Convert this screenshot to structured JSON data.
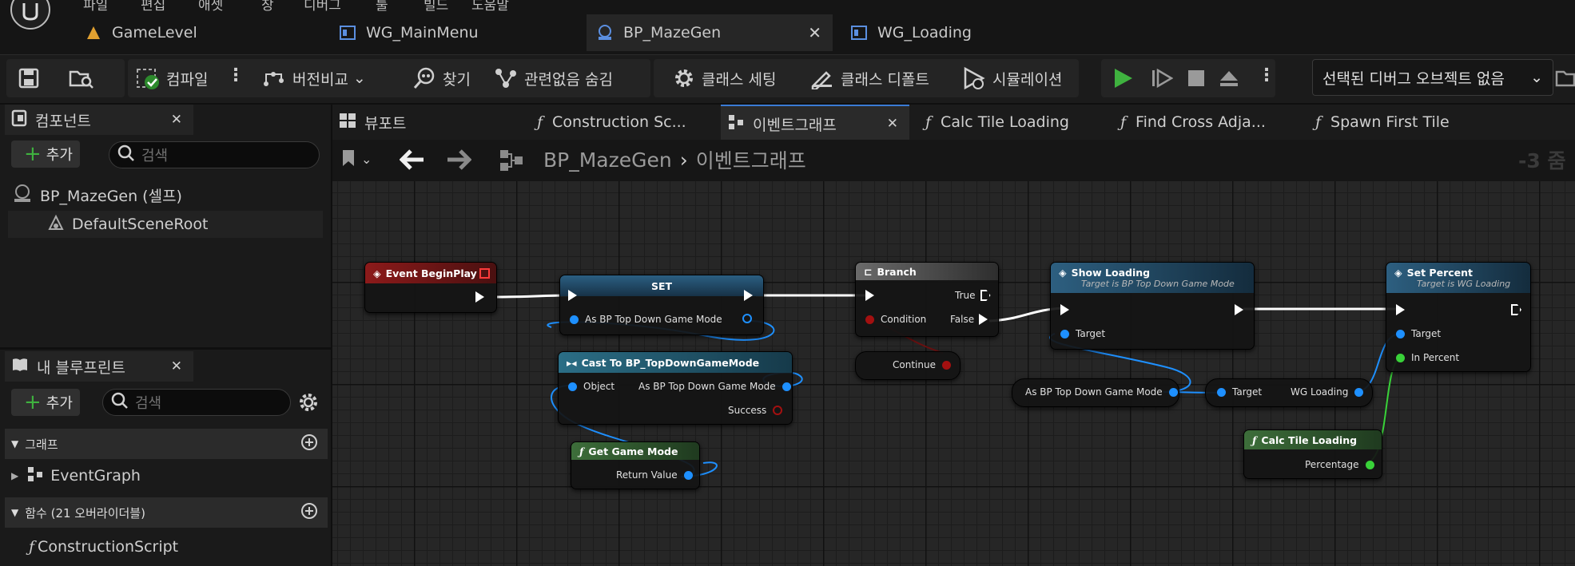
{
  "menu": [
    "파일",
    "편집",
    "애셋",
    "창",
    "디버그",
    "툴",
    "빌드",
    "도움말"
  ],
  "doc_tabs": [
    {
      "label": "GameLevel",
      "active": false
    },
    {
      "label": "WG_MainMenu",
      "active": false
    },
    {
      "label": "BP_MazeGen",
      "active": true
    },
    {
      "label": "WG_Loading",
      "active": false
    }
  ],
  "toolbar": {
    "compile": "컴파일",
    "diff": "버전비교",
    "find": "찾기",
    "hide_unrelated": "관련없음 숨김",
    "class_settings": "클래스 세팅",
    "class_defaults": "클래스 디폴트",
    "simulation": "시뮬레이션",
    "debug_object": "선택된 디버그 오브젝트 없음"
  },
  "components": {
    "tab": "컴포넌트",
    "add": "추가",
    "search_placeholder": "검색",
    "items": [
      "BP_MazeGen (셀프)",
      "DefaultSceneRoot"
    ]
  },
  "my_blueprint": {
    "tab": "내 블루프린트",
    "add": "추가",
    "search_placeholder": "검색",
    "graph_section": "그래프",
    "graph_items": [
      "EventGraph"
    ],
    "functions_section": "함수 (21 오버라이더블)",
    "function_items": [
      "ConstructionScript"
    ]
  },
  "graph_tabs": [
    {
      "label": "뷰포트",
      "active": false
    },
    {
      "label": "Construction Sc...",
      "active": false
    },
    {
      "label": "이벤트그래프",
      "active": true
    },
    {
      "label": "Calc Tile Loading",
      "active": false
    },
    {
      "label": "Find Cross Adja...",
      "active": false
    },
    {
      "label": "Spawn First Tile",
      "active": false
    }
  ],
  "breadcrumb": {
    "root": "BP_MazeGen",
    "current": "이벤트그래프",
    "zoom": "-3 줌"
  },
  "nodes": {
    "event_begin_play": "Event BeginPlay",
    "set": "SET",
    "set_pin": "As BP Top Down Game Mode",
    "cast": "Cast To BP_TopDownGameMode",
    "cast_object": "Object",
    "cast_as": "As BP Top Down Game Mode",
    "cast_success": "Success",
    "get_game_mode": "Get Game Mode",
    "return_value": "Return Value",
    "branch": "Branch",
    "branch_true": "True",
    "branch_condition": "Condition",
    "branch_false": "False",
    "continue": "Continue",
    "show_loading": "Show Loading",
    "show_loading_sub": "Target is BP Top Down Game Mode",
    "target": "Target",
    "get_var": "As BP Top Down Game Mode",
    "wg_target": "Target",
    "wg_loading": "WG Loading",
    "set_percent": "Set Percent",
    "set_percent_sub": "Target is WG Loading",
    "in_percent": "In Percent",
    "calc_tile": "Calc Tile Loading",
    "percentage": "Percentage"
  },
  "colors": {
    "object_pin": "#1e90ff",
    "bool_pin": "#a31010",
    "float_pin": "#39d239",
    "event_head": "#7a1414",
    "func_head": "#1d4a66",
    "pure_head": "#3e5f3a"
  }
}
